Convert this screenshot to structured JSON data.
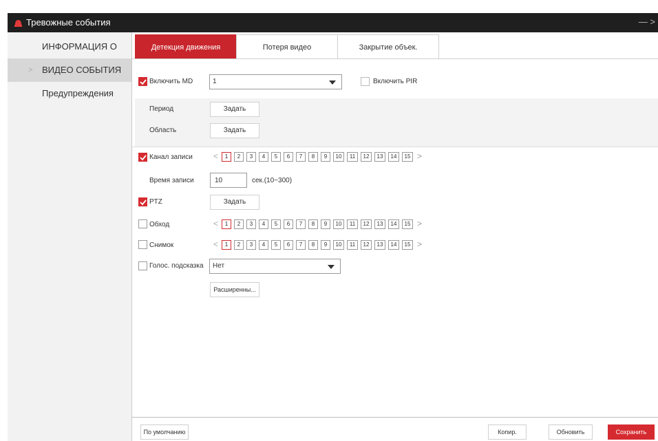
{
  "window": {
    "title": "Тревожные события",
    "controls": "— >"
  },
  "sidebar": {
    "items": [
      {
        "label": "ИНФОРМАЦИЯ О",
        "active": false
      },
      {
        "label": "ВИДЕО СОБЫТИЯ",
        "active": true,
        "arrow": ">"
      },
      {
        "label": "Предупреждения",
        "active": false
      }
    ]
  },
  "tabs": [
    {
      "label": "Детекция движения",
      "active": true
    },
    {
      "label": "Потеря видео",
      "active": false
    },
    {
      "label": "Закрытие объек.",
      "active": false
    }
  ],
  "form": {
    "enable_md": {
      "label": "Включить MD",
      "checked": true,
      "value": "1"
    },
    "enable_pir": {
      "label": "Включить PIR",
      "checked": false
    },
    "period": {
      "label": "Период",
      "button": "Задать"
    },
    "area": {
      "label": "Область",
      "button": "Задать"
    },
    "record_channel": {
      "label": "Канал записи",
      "checked": true,
      "selected": [
        "1"
      ]
    },
    "record_time": {
      "label": "Время записи",
      "value": "10",
      "unit": "сек.(10~300)"
    },
    "ptz": {
      "label": "PTZ",
      "checked": true,
      "button": "Задать"
    },
    "tour": {
      "label": "Обход",
      "checked": false,
      "selected": [
        "1"
      ]
    },
    "snapshot": {
      "label": "Снимок",
      "checked": false,
      "selected": [
        "1"
      ]
    },
    "voice": {
      "label": "Голос. подсказка",
      "checked": false,
      "value": "Нет"
    },
    "advanced_button": "Расширенны..."
  },
  "channels": [
    "1",
    "2",
    "3",
    "4",
    "5",
    "6",
    "7",
    "8",
    "9",
    "10",
    "11",
    "12",
    "13",
    "14",
    "15"
  ],
  "pager": {
    "prev": "<",
    "next": ">"
  },
  "footer": {
    "default_button": "По умолчанию",
    "copy_button": "Копир.",
    "refresh_button": "Обновить",
    "save_button": "Сохранить"
  },
  "colors": {
    "accent": "#d52b30",
    "titlebar": "#1f1f1f"
  }
}
